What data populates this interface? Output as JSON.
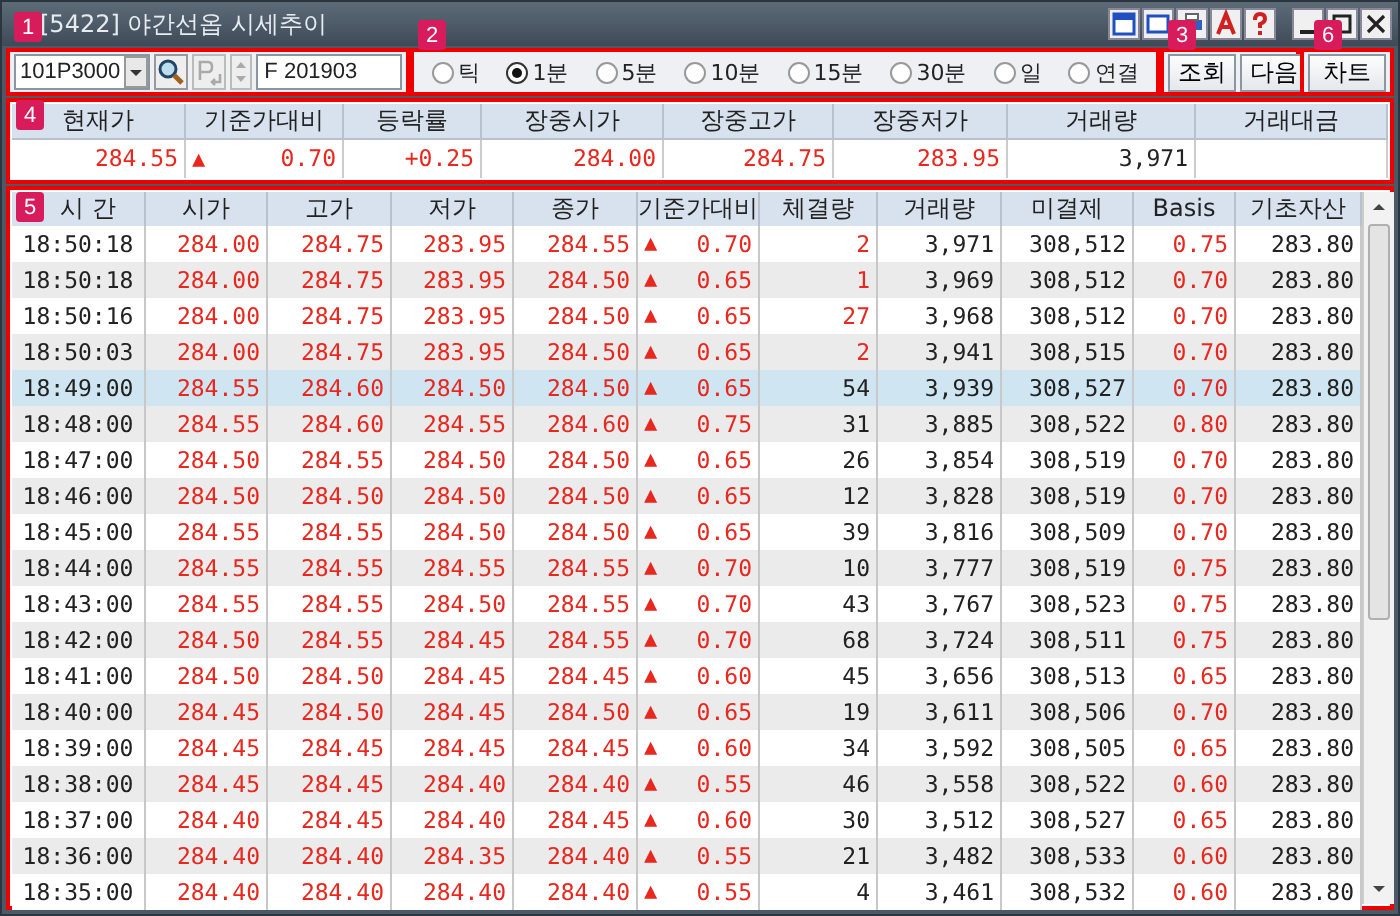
{
  "window": {
    "title": "[5422] 야간선옵 시세추이"
  },
  "code_panel": {
    "badge": "1",
    "code": "101P3000",
    "code_name": "F 201903"
  },
  "period_panel": {
    "badge": "2",
    "options": [
      {
        "label": "틱",
        "selected": false
      },
      {
        "label": "1분",
        "selected": true
      },
      {
        "label": "5분",
        "selected": false
      },
      {
        "label": "10분",
        "selected": false
      },
      {
        "label": "15분",
        "selected": false
      },
      {
        "label": "30분",
        "selected": false
      },
      {
        "label": "일",
        "selected": false
      },
      {
        "label": "연결",
        "selected": false
      }
    ]
  },
  "query_panel": {
    "badge": "3",
    "buttons": [
      "조회",
      "다음"
    ]
  },
  "chart_panel": {
    "badge": "6",
    "button": "차트"
  },
  "summary": {
    "badge": "4",
    "columns": [
      "현재가",
      "기준가대비",
      "등락률",
      "장중시가",
      "장중고가",
      "장중저가",
      "거래량",
      "거래대금"
    ],
    "current": "284.55",
    "arrow": "▲",
    "change": "0.70",
    "rate": "+0.25",
    "open": "284.00",
    "high": "284.75",
    "low": "283.95",
    "volume": "3,971"
  },
  "table": {
    "badge": "5",
    "columns": [
      "시 간",
      "시가",
      "고가",
      "저가",
      "종가",
      "기준가대비",
      "체결량",
      "거래량",
      "미결제",
      "Basis",
      "기초자산"
    ],
    "rows": [
      {
        "time": "18:50:18",
        "open": "284.00",
        "high": "284.75",
        "low": "283.95",
        "close": "284.55",
        "arrow": "▲",
        "change": "0.70",
        "qty": "2",
        "qty_up": true,
        "volume": "3,971",
        "oi": "308,512",
        "basis": "0.75",
        "underlying": "283.80",
        "selected": false
      },
      {
        "time": "18:50:18",
        "open": "284.00",
        "high": "284.75",
        "low": "283.95",
        "close": "284.50",
        "arrow": "▲",
        "change": "0.65",
        "qty": "1",
        "qty_up": true,
        "volume": "3,969",
        "oi": "308,512",
        "basis": "0.70",
        "underlying": "283.80",
        "selected": false
      },
      {
        "time": "18:50:16",
        "open": "284.00",
        "high": "284.75",
        "low": "283.95",
        "close": "284.50",
        "arrow": "▲",
        "change": "0.65",
        "qty": "27",
        "qty_up": true,
        "volume": "3,968",
        "oi": "308,512",
        "basis": "0.70",
        "underlying": "283.80",
        "selected": false
      },
      {
        "time": "18:50:03",
        "open": "284.00",
        "high": "284.75",
        "low": "283.95",
        "close": "284.50",
        "arrow": "▲",
        "change": "0.65",
        "qty": "2",
        "qty_up": true,
        "volume": "3,941",
        "oi": "308,515",
        "basis": "0.70",
        "underlying": "283.80",
        "selected": false
      },
      {
        "time": "18:49:00",
        "open": "284.55",
        "high": "284.60",
        "low": "284.50",
        "close": "284.50",
        "arrow": "▲",
        "change": "0.65",
        "qty": "54",
        "qty_up": false,
        "volume": "3,939",
        "oi": "308,527",
        "basis": "0.70",
        "underlying": "283.80",
        "selected": true
      },
      {
        "time": "18:48:00",
        "open": "284.55",
        "high": "284.60",
        "low": "284.55",
        "close": "284.60",
        "arrow": "▲",
        "change": "0.75",
        "qty": "31",
        "qty_up": false,
        "volume": "3,885",
        "oi": "308,522",
        "basis": "0.80",
        "underlying": "283.80",
        "selected": false
      },
      {
        "time": "18:47:00",
        "open": "284.50",
        "high": "284.55",
        "low": "284.50",
        "close": "284.50",
        "arrow": "▲",
        "change": "0.65",
        "qty": "26",
        "qty_up": false,
        "volume": "3,854",
        "oi": "308,519",
        "basis": "0.70",
        "underlying": "283.80",
        "selected": false
      },
      {
        "time": "18:46:00",
        "open": "284.50",
        "high": "284.50",
        "low": "284.50",
        "close": "284.50",
        "arrow": "▲",
        "change": "0.65",
        "qty": "12",
        "qty_up": false,
        "volume": "3,828",
        "oi": "308,519",
        "basis": "0.70",
        "underlying": "283.80",
        "selected": false
      },
      {
        "time": "18:45:00",
        "open": "284.55",
        "high": "284.55",
        "low": "284.50",
        "close": "284.50",
        "arrow": "▲",
        "change": "0.65",
        "qty": "39",
        "qty_up": false,
        "volume": "3,816",
        "oi": "308,509",
        "basis": "0.70",
        "underlying": "283.80",
        "selected": false
      },
      {
        "time": "18:44:00",
        "open": "284.55",
        "high": "284.55",
        "low": "284.55",
        "close": "284.55",
        "arrow": "▲",
        "change": "0.70",
        "qty": "10",
        "qty_up": false,
        "volume": "3,777",
        "oi": "308,519",
        "basis": "0.75",
        "underlying": "283.80",
        "selected": false
      },
      {
        "time": "18:43:00",
        "open": "284.55",
        "high": "284.55",
        "low": "284.50",
        "close": "284.55",
        "arrow": "▲",
        "change": "0.70",
        "qty": "43",
        "qty_up": false,
        "volume": "3,767",
        "oi": "308,523",
        "basis": "0.75",
        "underlying": "283.80",
        "selected": false
      },
      {
        "time": "18:42:00",
        "open": "284.50",
        "high": "284.55",
        "low": "284.45",
        "close": "284.55",
        "arrow": "▲",
        "change": "0.70",
        "qty": "68",
        "qty_up": false,
        "volume": "3,724",
        "oi": "308,511",
        "basis": "0.75",
        "underlying": "283.80",
        "selected": false
      },
      {
        "time": "18:41:00",
        "open": "284.50",
        "high": "284.50",
        "low": "284.45",
        "close": "284.45",
        "arrow": "▲",
        "change": "0.60",
        "qty": "45",
        "qty_up": false,
        "volume": "3,656",
        "oi": "308,513",
        "basis": "0.65",
        "underlying": "283.80",
        "selected": false
      },
      {
        "time": "18:40:00",
        "open": "284.45",
        "high": "284.50",
        "low": "284.45",
        "close": "284.50",
        "arrow": "▲",
        "change": "0.65",
        "qty": "19",
        "qty_up": false,
        "volume": "3,611",
        "oi": "308,506",
        "basis": "0.70",
        "underlying": "283.80",
        "selected": false
      },
      {
        "time": "18:39:00",
        "open": "284.45",
        "high": "284.45",
        "low": "284.45",
        "close": "284.45",
        "arrow": "▲",
        "change": "0.60",
        "qty": "34",
        "qty_up": false,
        "volume": "3,592",
        "oi": "308,505",
        "basis": "0.65",
        "underlying": "283.80",
        "selected": false
      },
      {
        "time": "18:38:00",
        "open": "284.45",
        "high": "284.45",
        "low": "284.40",
        "close": "284.40",
        "arrow": "▲",
        "change": "0.55",
        "qty": "46",
        "qty_up": false,
        "volume": "3,558",
        "oi": "308,522",
        "basis": "0.60",
        "underlying": "283.80",
        "selected": false
      },
      {
        "time": "18:37:00",
        "open": "284.40",
        "high": "284.45",
        "low": "284.40",
        "close": "284.45",
        "arrow": "▲",
        "change": "0.60",
        "qty": "30",
        "qty_up": false,
        "volume": "3,512",
        "oi": "308,527",
        "basis": "0.65",
        "underlying": "283.80",
        "selected": false
      },
      {
        "time": "18:36:00",
        "open": "284.40",
        "high": "284.40",
        "low": "284.35",
        "close": "284.40",
        "arrow": "▲",
        "change": "0.55",
        "qty": "21",
        "qty_up": false,
        "volume": "3,482",
        "oi": "308,533",
        "basis": "0.60",
        "underlying": "283.80",
        "selected": false
      },
      {
        "time": "18:35:00",
        "open": "284.40",
        "high": "284.40",
        "low": "284.40",
        "close": "284.40",
        "arrow": "▲",
        "change": "0.55",
        "qty": "4",
        "qty_up": false,
        "volume": "3,461",
        "oi": "308,532",
        "basis": "0.60",
        "underlying": "283.80",
        "selected": false
      }
    ]
  }
}
